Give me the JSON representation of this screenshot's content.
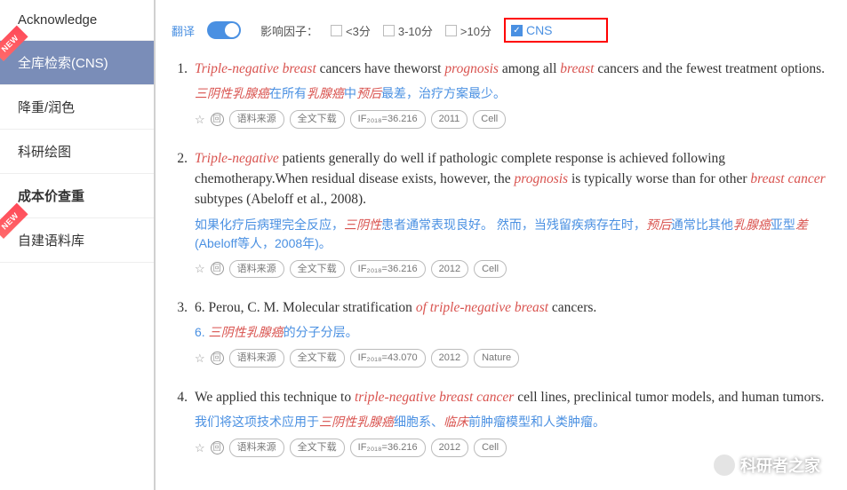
{
  "sidebar": {
    "items": [
      {
        "label": "Acknowledge",
        "new": false,
        "active": false
      },
      {
        "label": "全库检索(CNS)",
        "new": true,
        "active": true
      },
      {
        "label": "降重/润色",
        "new": false,
        "active": false
      },
      {
        "label": "科研绘图",
        "new": false,
        "active": false
      },
      {
        "label": "成本价查重",
        "new": false,
        "active": false
      },
      {
        "label": "自建语料库",
        "new": true,
        "active": false
      }
    ],
    "new_badge": "NEW"
  },
  "filter": {
    "translate": "翻译",
    "factor_label": "影响因子：",
    "opt1": "<3分",
    "opt2": "3-10分",
    "opt3": ">10分",
    "cns": "CNS",
    "check": "✓"
  },
  "results": [
    {
      "num": "1.",
      "en_parts": [
        "Triple-negative breast",
        " cancers have theworst ",
        "prognosis",
        " among all ",
        "breast",
        " cancers and the fewest treatment options."
      ],
      "zh_parts": [
        "三阴性乳腺癌",
        "在所有",
        "乳腺癌",
        "中",
        "预后",
        "最差，治疗方案最少。"
      ],
      "tags": {
        "src": "语料来源",
        "dl": "全文下载",
        "if": "IF₂₀₁₈=36.216",
        "yr": "2011",
        "j": "Cell"
      }
    },
    {
      "num": "2.",
      "en_parts": [
        "Triple-negative",
        " patients generally do well if pathologic complete response is achieved following chemotherapy.When residual disease exists, however, the ",
        "prognosis",
        " is typically worse than for other ",
        "breast cancer",
        " subtypes (Abeloff et al., 2008)."
      ],
      "zh_parts": [
        "如果化疗后病理完全反应，",
        "三阴性",
        "患者通常表现良好。 然而，当残留疾病存在时，",
        "预后",
        "通常比其他",
        "乳腺癌",
        "亚型",
        "差",
        "(Abeloff等人，2008年)。"
      ],
      "tags": {
        "src": "语料来源",
        "dl": "全文下载",
        "if": "IF₂₀₁₈=36.216",
        "yr": "2012",
        "j": "Cell"
      }
    },
    {
      "num": "3.",
      "en_parts": [
        "6. Perou, C. M. Molecular stratification ",
        "of triple-negative breast",
        " cancers."
      ],
      "zh_parts": [
        "6. ",
        "三阴性乳腺癌",
        "的分子分层。"
      ],
      "tags": {
        "src": "语料来源",
        "dl": "全文下载",
        "if": "IF₂₀₁₈=43.070",
        "yr": "2012",
        "j": "Nature"
      }
    },
    {
      "num": "4.",
      "en_parts": [
        "We applied this technique to ",
        "triple-negative breast cancer",
        " cell lines, preclinical tumor models, and human tumors."
      ],
      "zh_parts": [
        "我们将这项技术应用于",
        "三阴性乳腺癌",
        "细胞系、",
        "临床",
        "前肿瘤模型和人类肿瘤。"
      ],
      "tags": {
        "src": "语料来源",
        "dl": "全文下载",
        "if": "IF₂₀₁₈=36.216",
        "yr": "2012",
        "j": "Cell"
      }
    }
  ],
  "tag_copy": "回",
  "watermark": "科研者之家"
}
